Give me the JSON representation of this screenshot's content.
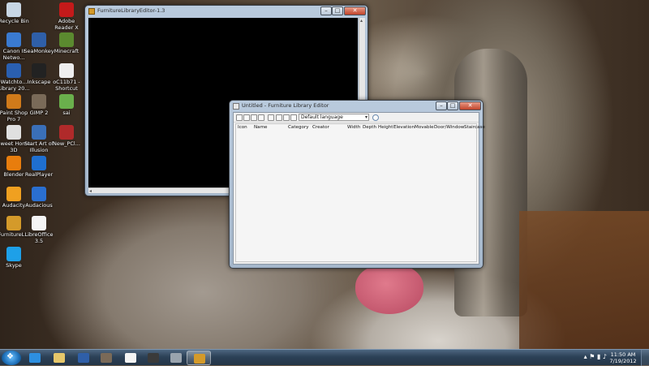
{
  "desktop_icons": [
    {
      "name": "recycle-bin-icon",
      "label": "Recycle Bin",
      "color": "#c8d6e4"
    },
    {
      "name": "adobe-reader-icon",
      "label": "Adobe Reader X",
      "color": "#c41a1a"
    },
    {
      "name": "canon-network-icon",
      "label": "Canon II Netwo...",
      "color": "#3a7ad0"
    },
    {
      "name": "seamonkey-icon",
      "label": "SeaMonkey",
      "color": "#2f5fa8"
    },
    {
      "name": "minecraft-icon",
      "label": "Minecraft",
      "color": "#5b8a2f"
    },
    {
      "name": "watchtower-library-icon",
      "label": "Watchto... Library 20...",
      "color": "#2a5fb0"
    },
    {
      "name": "inkscape-icon",
      "label": "Inkscape",
      "color": "#222222"
    },
    {
      "name": "shortcut-icon",
      "label": "oC11b71 - Shortcut",
      "color": "#eeeeee"
    },
    {
      "name": "paint-shop-pro-icon",
      "label": "Paint Shop Pro 7",
      "color": "#d07a1a"
    },
    {
      "name": "gimp-icon",
      "label": "GIMP 2",
      "color": "#7a6a58"
    },
    {
      "name": "sai-icon",
      "label": "sai",
      "color": "#6ab04c"
    },
    {
      "name": "sweet-home-3d-icon",
      "label": "Sweet Home 3D",
      "color": "#e0e0e0"
    },
    {
      "name": "start-art-of-illusion-icon",
      "label": "Start Art of Illusion",
      "color": "#3a6fb8"
    },
    {
      "name": "new-pcl-icon",
      "label": "New_PCl...",
      "color": "#b02a2a"
    },
    {
      "name": "blender-icon",
      "label": "Blender",
      "color": "#e87d0d"
    },
    {
      "name": "realplayer-icon",
      "label": "RealPlayer",
      "color": "#1f6fd0"
    },
    {
      "name": "audacity-icon",
      "label": "Audacity",
      "color": "#f0a020"
    },
    {
      "name": "audacious-icon",
      "label": "Audacious",
      "color": "#2a6fd0"
    },
    {
      "name": "furniture-library-icon",
      "label": "FurnitureL...",
      "color": "#d49a2a"
    },
    {
      "name": "libreoffice-icon",
      "label": "LibreOffice 3.5",
      "color": "#f4f4f4"
    },
    {
      "name": "skype-icon",
      "label": "Skype",
      "color": "#1ea0e8"
    }
  ],
  "console_window": {
    "title": "FurnitureLibraryEditor-1.3",
    "minimize": "–",
    "maximize": "□",
    "close": "✕",
    "scroll_left": "◂",
    "scroll_right": "▸",
    "scroll_up": "▴",
    "scroll_down": "▾"
  },
  "editor_window": {
    "title": "Untitled - Furniture Library Editor",
    "minimize": "–",
    "maximize": "□",
    "close": "✕",
    "language": "Default language",
    "language_arrow": "▾",
    "toolbar_icons": [
      "new-file-icon",
      "open-icon",
      "save-icon",
      "save-as-icon",
      "cut-icon",
      "import-icon",
      "modify-icon",
      "delete-icon",
      "help-icon"
    ],
    "columns": [
      "Icon",
      "Name",
      "Category",
      "Creator",
      "Width",
      "Depth",
      "Height",
      "Elevation",
      "Movable",
      "Door/Window",
      "Staircase"
    ]
  },
  "taskbar": {
    "start_glyph": "❖",
    "pinned": [
      {
        "name": "internet-explorer-icon",
        "color": "#2d8fe0"
      },
      {
        "name": "windows-explorer-icon",
        "color": "#e6c76a"
      },
      {
        "name": "seamonkey-task-icon",
        "color": "#2f5fa8"
      },
      {
        "name": "gimp-task-icon",
        "color": "#7a6a58"
      },
      {
        "name": "blank-document-icon",
        "color": "#f4f4f4"
      },
      {
        "name": "steam-icon",
        "color": "#3a3a3a"
      },
      {
        "name": "game-controller-icon",
        "color": "#9aa4ae"
      },
      {
        "name": "furniture-library-task-icon",
        "color": "#d49a2a"
      }
    ],
    "tray_icons": "▴ ⚑ ▮ ♪",
    "time": "11:50 AM",
    "date": "7/19/2012"
  }
}
